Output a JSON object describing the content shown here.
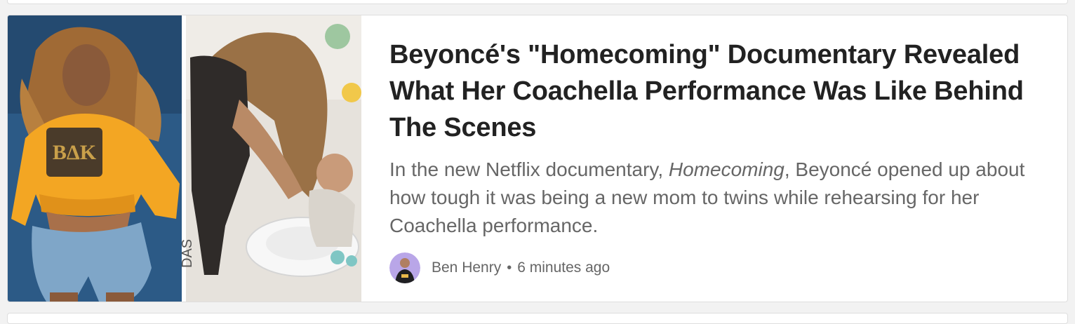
{
  "article": {
    "headline": "Beyoncé's \"Homecoming\" Documentary Revealed What Her Coachella Performance Was Like Behind The Scenes",
    "description_before": "In the new Netflix documentary, ",
    "description_italic": "Homecoming",
    "description_after": ", Beyoncé opened up about how tough it was being a new mom to twins while rehearsing for her Coachella performance.",
    "author": "Ben Henry",
    "separator": "•",
    "timestamp": "6 minutes ago"
  },
  "colors": {
    "headline": "#222222",
    "body_text": "#666666",
    "card_border": "#dedede",
    "page_background": "#f2f2f2",
    "avatar_background": "#b9a6e8"
  }
}
